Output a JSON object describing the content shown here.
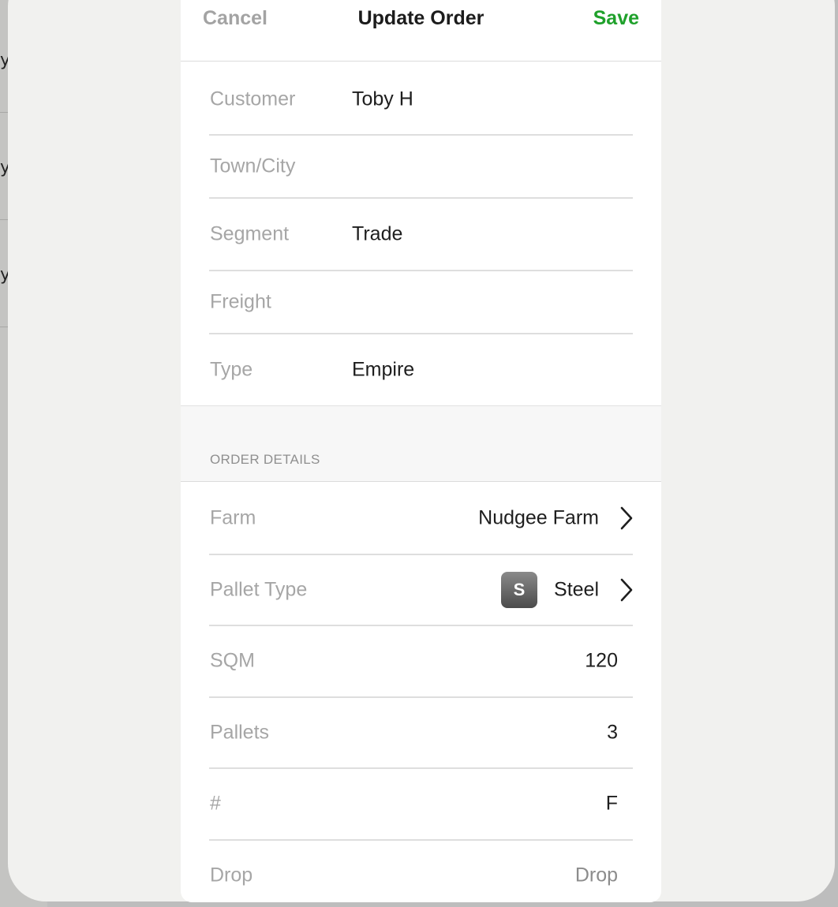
{
  "background": {
    "row_chars": [
      "y",
      "y",
      "y"
    ]
  },
  "navbar": {
    "cancel_label": "Cancel",
    "title": "Update Order",
    "save_label": "Save"
  },
  "customer_section": {
    "customer": {
      "label": "Customer",
      "value": "Toby H"
    },
    "town_city": {
      "label": "Town/City",
      "value": ""
    },
    "segment": {
      "label": "Segment",
      "value": "Trade"
    },
    "freight": {
      "label": "Freight",
      "value": ""
    },
    "type": {
      "label": "Type",
      "value": "Empire"
    }
  },
  "order_details": {
    "section_title": "ORDER DETAILS",
    "farm": {
      "label": "Farm",
      "value": "Nudgee Farm"
    },
    "pallet_type": {
      "label": "Pallet Type",
      "badge": "S",
      "value": "Steel"
    },
    "sqm": {
      "label": "SQM",
      "value": "120"
    },
    "pallets": {
      "label": "Pallets",
      "value": "3"
    },
    "hash": {
      "label": "#",
      "value": "F"
    },
    "drop": {
      "label": "Drop",
      "value": "Drop"
    }
  },
  "colors": {
    "save": "#1fa12b",
    "cancel": "#a3a3a3",
    "label": "#a6a6a6",
    "value": "#1e1e1e"
  },
  "icons": [
    "chevron-right-icon"
  ]
}
